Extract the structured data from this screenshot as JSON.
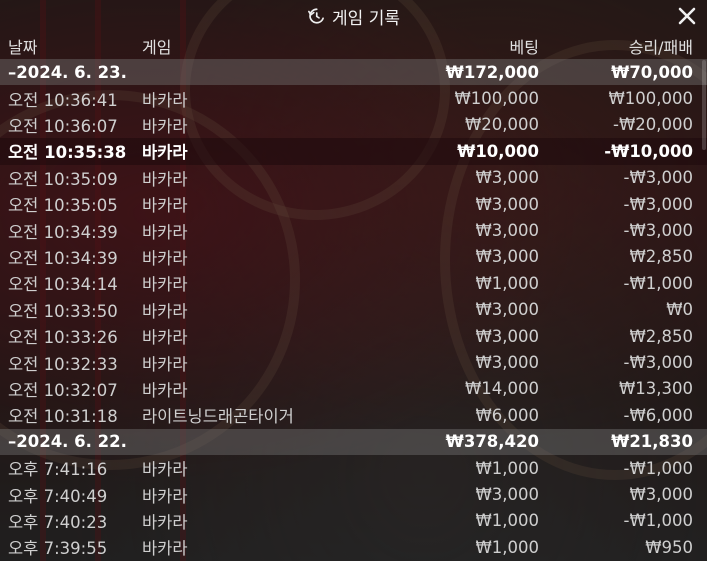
{
  "header": {
    "title": "게임 기록",
    "history_icon": "history-icon",
    "close_icon": "close-icon"
  },
  "columns": {
    "date": "날짜",
    "game": "게임",
    "bet": "베팅",
    "result": "승리/패배"
  },
  "groups": [
    {
      "date": "–2024. 6. 23.",
      "bet_total": "₩172,000",
      "result_total": "₩70,000",
      "rows": [
        {
          "time": "오전 10:36:41",
          "game": "바카라",
          "bet": "₩100,000",
          "result": "₩100,000"
        },
        {
          "time": "오전 10:36:07",
          "game": "바카라",
          "bet": "₩20,000",
          "result": "-₩20,000"
        },
        {
          "time": "오전 10:35:38",
          "game": "바카라",
          "bet": "₩10,000",
          "result": "-₩10,000"
        },
        {
          "time": "오전 10:35:09",
          "game": "바카라",
          "bet": "₩3,000",
          "result": "-₩3,000"
        },
        {
          "time": "오전 10:35:05",
          "game": "바카라",
          "bet": "₩3,000",
          "result": "-₩3,000"
        },
        {
          "time": "오전 10:34:39",
          "game": "바카라",
          "bet": "₩3,000",
          "result": "-₩3,000"
        },
        {
          "time": "오전 10:34:39",
          "game": "바카라",
          "bet": "₩3,000",
          "result": "₩2,850"
        },
        {
          "time": "오전 10:34:14",
          "game": "바카라",
          "bet": "₩1,000",
          "result": "-₩1,000"
        },
        {
          "time": "오전 10:33:50",
          "game": "바카라",
          "bet": "₩3,000",
          "result": "₩0"
        },
        {
          "time": "오전 10:33:26",
          "game": "바카라",
          "bet": "₩3,000",
          "result": "₩2,850"
        },
        {
          "time": "오전 10:32:33",
          "game": "바카라",
          "bet": "₩3,000",
          "result": "-₩3,000"
        },
        {
          "time": "오전 10:32:07",
          "game": "바카라",
          "bet": "₩14,000",
          "result": "₩13,300"
        },
        {
          "time": "오전 10:31:18",
          "game": "라이트닝드래곤타이거",
          "bet": "₩6,000",
          "result": "-₩6,000"
        }
      ]
    },
    {
      "date": "–2024. 6. 22.",
      "bet_total": "₩378,420",
      "result_total": "₩21,830",
      "rows": [
        {
          "time": "오후 7:41:16",
          "game": "바카라",
          "bet": "₩1,000",
          "result": "-₩1,000"
        },
        {
          "time": "오후 7:40:49",
          "game": "바카라",
          "bet": "₩3,000",
          "result": "₩3,000"
        },
        {
          "time": "오후 7:40:23",
          "game": "바카라",
          "bet": "₩1,000",
          "result": "-₩1,000"
        },
        {
          "time": "오후 7:39:55",
          "game": "바카라",
          "bet": "₩1,000",
          "result": "₩950"
        }
      ]
    }
  ]
}
